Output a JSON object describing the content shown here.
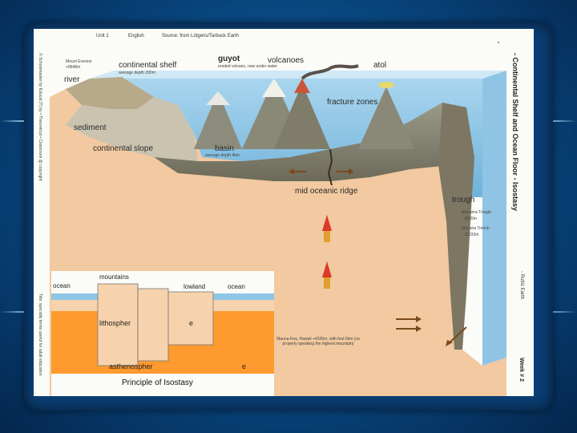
{
  "header": {
    "unit": "Unit 1",
    "language": "English",
    "source": "Source: from Lütgens/Tarbuck Earth"
  },
  "side_title": "- Continental Shelf and Ocean Floor - Isostasy",
  "side_code": "- Ruttiz Earth",
  "side_page": "Week # 2",
  "copyright_top": "© Schoolmaster by Educat (T) by • Theoretical • Classroom @ copyright",
  "copyright_bottom": "Title: specialty terms useful for adult education",
  "labels": {
    "mount_everest": "Mount Everest",
    "mount_everest_height": "+8848m",
    "continental_shelf": "continental shelf",
    "shelf_depth": "average depth 200m",
    "guyot": "guyot",
    "guyot_note": "eroded volcano, now under water",
    "volcanoes": "volcanoes",
    "atol": "atol",
    "river": "river",
    "fracture_zones": "fracture zones",
    "sediment": "sediment",
    "continental_slope": "continental slope",
    "basin": "basin",
    "basin_depth": "average depth 4km",
    "mid_oceanic_ridge": "mid oceanic ridge",
    "trough": "trough",
    "atacama_trough": "Atacama Trough",
    "atacama_depth": "-8065m",
    "mariana_trench": "Mariana Trench",
    "mariana_depth": "-11033m",
    "mauna_kea_note": "Mauna Kea, Hawaii +4205m, with foot 6km (ca properly speaking the highest mountain)"
  },
  "isostasy": {
    "mountains": "mountains",
    "ocean_left": "ocean",
    "lowland": "lowland",
    "ocean_right": "ocean",
    "lithosphere": "lithospher",
    "lithosphere_e": "e",
    "asthenosphere": "asthenospher",
    "asthenosphere_e": "e",
    "caption": "Principle of Isostasy"
  },
  "colors": {
    "background": "#0a4f8c",
    "ocean": "#8cc6e6",
    "crust": "#f2c9a0",
    "asthenosphere": "#ff9a2e",
    "lithosphere": "#f6d2ad"
  }
}
